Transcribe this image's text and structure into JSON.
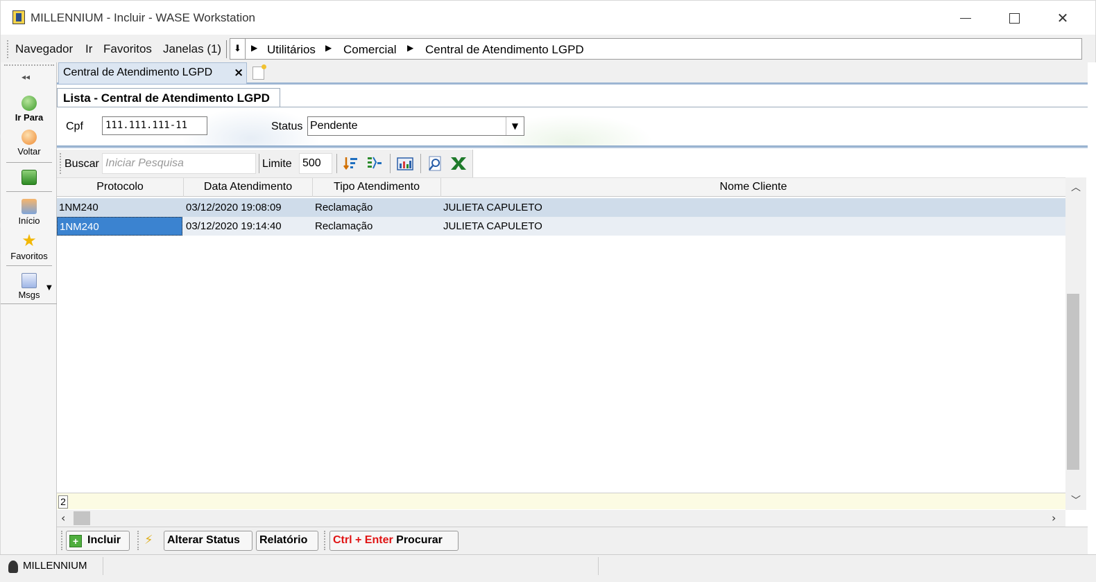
{
  "window": {
    "title": "MILLENNIUM - Incluir - WASE Workstation"
  },
  "menu": {
    "items": [
      "Navegador",
      "Ir",
      "Favoritos",
      "Janelas (1)"
    ]
  },
  "breadcrumb": [
    "Utilitários",
    "Comercial",
    "Central de Atendimento LGPD"
  ],
  "sidebar": {
    "ir_para": "Ir Para",
    "voltar": "Voltar",
    "inicio": "Início",
    "favoritos": "Favoritos",
    "msgs": "Msgs",
    "brand": "Millennium"
  },
  "doc_tab": {
    "label": "Central de Atendimento LGPD"
  },
  "sub_tab": {
    "label": "Lista - Central de Atendimento LGPD"
  },
  "filters": {
    "cpf_label": "Cpf",
    "cpf_value": "111.111.111-11",
    "status_label": "Status",
    "status_value": "Pendente"
  },
  "search": {
    "label": "Buscar",
    "placeholder": "Iniciar Pesquisa",
    "limit_label": "Limite",
    "limit_value": "500"
  },
  "grid": {
    "columns": [
      "Protocolo",
      "Data Atendimento",
      "Tipo Atendimento",
      "Nome Cliente"
    ],
    "rows": [
      [
        "1NM240",
        "03/12/2020 19:08:09",
        "Reclamação",
        "JULIETA CAPULETO"
      ],
      [
        "1NM240",
        "03/12/2020 19:14:40",
        "Reclamação",
        "JULIETA CAPULETO"
      ]
    ],
    "count": "2"
  },
  "actions": {
    "incluir": "Incluir",
    "alterar_status": "Alterar Status",
    "relatorio": "Relatório",
    "shortcut": "Ctrl + Enter",
    "procurar": "Procurar"
  },
  "statusbar": {
    "app": "MILLENNIUM"
  },
  "colors": {
    "selection": "#3b83d0",
    "row_highlight": "#cfdcea",
    "accent_blue": "#7e9fc3",
    "shortcut_red": "#e01414"
  }
}
